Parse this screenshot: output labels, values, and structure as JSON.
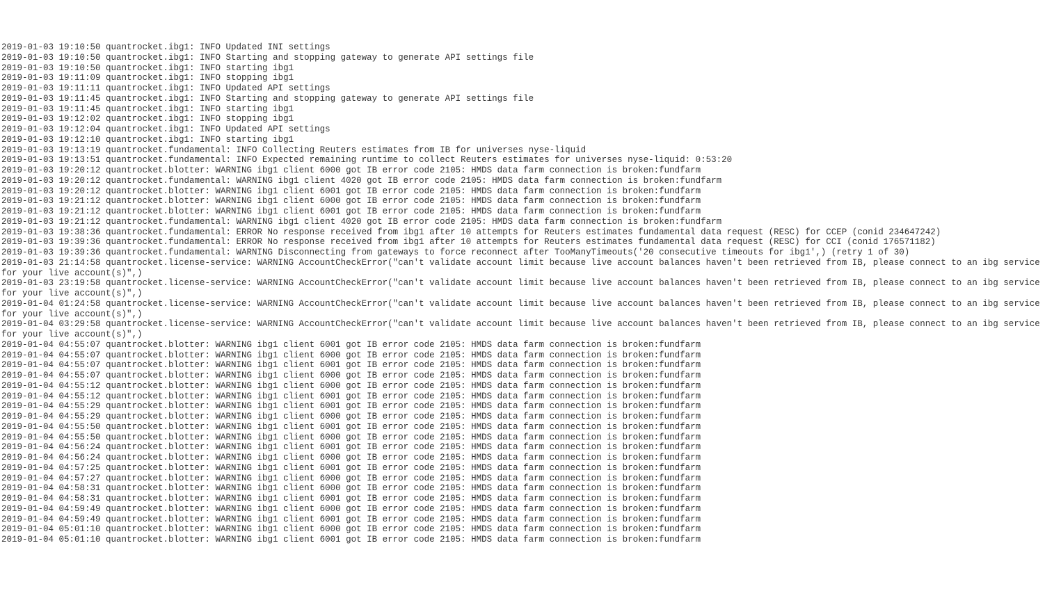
{
  "lines": [
    "2019-01-03 19:10:50 quantrocket.ibg1: INFO Updated INI settings",
    "2019-01-03 19:10:50 quantrocket.ibg1: INFO Starting and stopping gateway to generate API settings file",
    "2019-01-03 19:10:50 quantrocket.ibg1: INFO starting ibg1",
    "2019-01-03 19:11:09 quantrocket.ibg1: INFO stopping ibg1",
    "2019-01-03 19:11:11 quantrocket.ibg1: INFO Updated API settings",
    "2019-01-03 19:11:45 quantrocket.ibg1: INFO Starting and stopping gateway to generate API settings file",
    "2019-01-03 19:11:45 quantrocket.ibg1: INFO starting ibg1",
    "2019-01-03 19:12:02 quantrocket.ibg1: INFO stopping ibg1",
    "2019-01-03 19:12:04 quantrocket.ibg1: INFO Updated API settings",
    "2019-01-03 19:12:10 quantrocket.ibg1: INFO starting ibg1",
    "2019-01-03 19:13:19 quantrocket.fundamental: INFO Collecting Reuters estimates from IB for universes nyse-liquid",
    "2019-01-03 19:13:51 quantrocket.fundamental: INFO Expected remaining runtime to collect Reuters estimates for universes nyse-liquid: 0:53:20",
    "2019-01-03 19:20:12 quantrocket.blotter: WARNING ibg1 client 6000 got IB error code 2105: HMDS data farm connection is broken:fundfarm",
    "2019-01-03 19:20:12 quantrocket.fundamental: WARNING ibg1 client 4020 got IB error code 2105: HMDS data farm connection is broken:fundfarm",
    "2019-01-03 19:20:12 quantrocket.blotter: WARNING ibg1 client 6001 got IB error code 2105: HMDS data farm connection is broken:fundfarm",
    "2019-01-03 19:21:12 quantrocket.blotter: WARNING ibg1 client 6000 got IB error code 2105: HMDS data farm connection is broken:fundfarm",
    "2019-01-03 19:21:12 quantrocket.blotter: WARNING ibg1 client 6001 got IB error code 2105: HMDS data farm connection is broken:fundfarm",
    "2019-01-03 19:21:12 quantrocket.fundamental: WARNING ibg1 client 4020 got IB error code 2105: HMDS data farm connection is broken:fundfarm",
    "2019-01-03 19:38:36 quantrocket.fundamental: ERROR No response received from ibg1 after 10 attempts for Reuters estimates fundamental data request (RESC) for CCEP (conid 234647242)",
    "2019-01-03 19:39:36 quantrocket.fundamental: ERROR No response received from ibg1 after 10 attempts for Reuters estimates fundamental data request (RESC) for CCI (conid 176571182)",
    "2019-01-03 19:39:36 quantrocket.fundamental: WARNING Disconnecting from gateways to force reconnect after TooManyTimeouts('20 consecutive timeouts for ibg1',) (retry 1 of 30)",
    "2019-01-03 21:14:58 quantrocket.license-service: WARNING AccountCheckError(\"can't validate account limit because live account balances haven't been retrieved from IB, please connect to an ibg service for your live account(s)\",)",
    "2019-01-03 23:19:58 quantrocket.license-service: WARNING AccountCheckError(\"can't validate account limit because live account balances haven't been retrieved from IB, please connect to an ibg service for your live account(s)\",)",
    "2019-01-04 01:24:58 quantrocket.license-service: WARNING AccountCheckError(\"can't validate account limit because live account balances haven't been retrieved from IB, please connect to an ibg service for your live account(s)\",)",
    "2019-01-04 03:29:58 quantrocket.license-service: WARNING AccountCheckError(\"can't validate account limit because live account balances haven't been retrieved from IB, please connect to an ibg service for your live account(s)\",)",
    "2019-01-04 04:55:07 quantrocket.blotter: WARNING ibg1 client 6001 got IB error code 2105: HMDS data farm connection is broken:fundfarm",
    "2019-01-04 04:55:07 quantrocket.blotter: WARNING ibg1 client 6000 got IB error code 2105: HMDS data farm connection is broken:fundfarm",
    "2019-01-04 04:55:07 quantrocket.blotter: WARNING ibg1 client 6001 got IB error code 2105: HMDS data farm connection is broken:fundfarm",
    "2019-01-04 04:55:07 quantrocket.blotter: WARNING ibg1 client 6000 got IB error code 2105: HMDS data farm connection is broken:fundfarm",
    "2019-01-04 04:55:12 quantrocket.blotter: WARNING ibg1 client 6000 got IB error code 2105: HMDS data farm connection is broken:fundfarm",
    "2019-01-04 04:55:12 quantrocket.blotter: WARNING ibg1 client 6001 got IB error code 2105: HMDS data farm connection is broken:fundfarm",
    "2019-01-04 04:55:29 quantrocket.blotter: WARNING ibg1 client 6001 got IB error code 2105: HMDS data farm connection is broken:fundfarm",
    "2019-01-04 04:55:29 quantrocket.blotter: WARNING ibg1 client 6000 got IB error code 2105: HMDS data farm connection is broken:fundfarm",
    "2019-01-04 04:55:50 quantrocket.blotter: WARNING ibg1 client 6001 got IB error code 2105: HMDS data farm connection is broken:fundfarm",
    "2019-01-04 04:55:50 quantrocket.blotter: WARNING ibg1 client 6000 got IB error code 2105: HMDS data farm connection is broken:fundfarm",
    "2019-01-04 04:56:24 quantrocket.blotter: WARNING ibg1 client 6001 got IB error code 2105: HMDS data farm connection is broken:fundfarm",
    "2019-01-04 04:56:24 quantrocket.blotter: WARNING ibg1 client 6000 got IB error code 2105: HMDS data farm connection is broken:fundfarm",
    "2019-01-04 04:57:25 quantrocket.blotter: WARNING ibg1 client 6001 got IB error code 2105: HMDS data farm connection is broken:fundfarm",
    "2019-01-04 04:57:27 quantrocket.blotter: WARNING ibg1 client 6000 got IB error code 2105: HMDS data farm connection is broken:fundfarm",
    "2019-01-04 04:58:31 quantrocket.blotter: WARNING ibg1 client 6000 got IB error code 2105: HMDS data farm connection is broken:fundfarm",
    "2019-01-04 04:58:31 quantrocket.blotter: WARNING ibg1 client 6001 got IB error code 2105: HMDS data farm connection is broken:fundfarm",
    "2019-01-04 04:59:49 quantrocket.blotter: WARNING ibg1 client 6000 got IB error code 2105: HMDS data farm connection is broken:fundfarm",
    "2019-01-04 04:59:49 quantrocket.blotter: WARNING ibg1 client 6001 got IB error code 2105: HMDS data farm connection is broken:fundfarm",
    "2019-01-04 05:01:10 quantrocket.blotter: WARNING ibg1 client 6000 got IB error code 2105: HMDS data farm connection is broken:fundfarm",
    "2019-01-04 05:01:10 quantrocket.blotter: WARNING ibg1 client 6001 got IB error code 2105: HMDS data farm connection is broken:fundfarm"
  ]
}
